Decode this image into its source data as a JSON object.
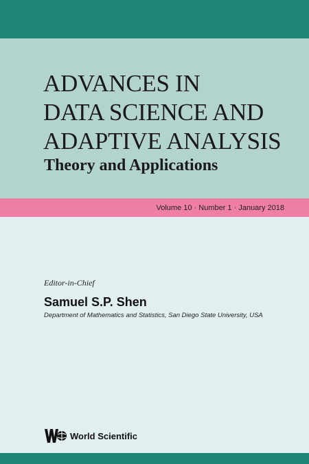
{
  "cover": {
    "title_lines": [
      "ADVANCES IN",
      "DATA SCIENCE AND",
      "ADAPTIVE ANALYSIS"
    ],
    "subtitle": "Theory and Applications",
    "issue": "Volume 10 · Number 1 · January 2018",
    "editor_role": "Editor-in-Chief",
    "editor_name": "Samuel S.P. Shen",
    "editor_affiliation": "Department of Mathematics and Statistics, San Diego State University, USA",
    "publisher": "World Scientific",
    "publisher_logo_icon": "world-scientific-logo-icon"
  },
  "colors": {
    "band_teal": "#1f8577",
    "title_panel": "#b3d3cf",
    "issue_band_pink": "#f07fa5",
    "page_background": "#e2eff1"
  }
}
